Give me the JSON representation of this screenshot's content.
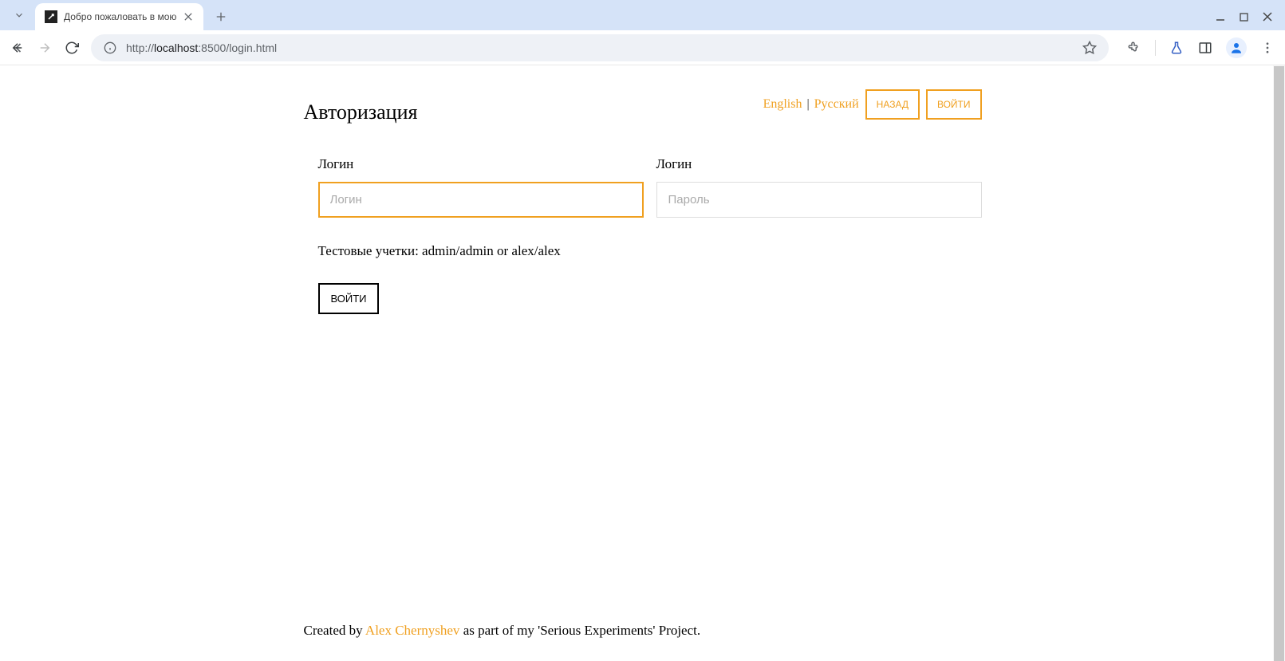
{
  "browser": {
    "tab_title": "Добро пожаловать в мою",
    "url_prefix": "http://",
    "url_host": "localhost",
    "url_path": ":8500/login.html"
  },
  "header": {
    "title": "Авторизация",
    "lang_english": "English",
    "lang_separator": "|",
    "lang_russian": "Русский",
    "back_button": "НАЗАД",
    "login_button": "ВОЙТИ"
  },
  "form": {
    "login_label": "Логин",
    "login_placeholder": "Логин",
    "password_label": "Логин",
    "password_placeholder": "Пароль",
    "hint": "Тестовые учетки: admin/admin or alex/alex",
    "submit": "ВОЙТИ"
  },
  "footer": {
    "prefix": "Created by ",
    "author": "Alex Chernyshev",
    "suffix": " as part of my 'Serious Experiments' Project."
  }
}
